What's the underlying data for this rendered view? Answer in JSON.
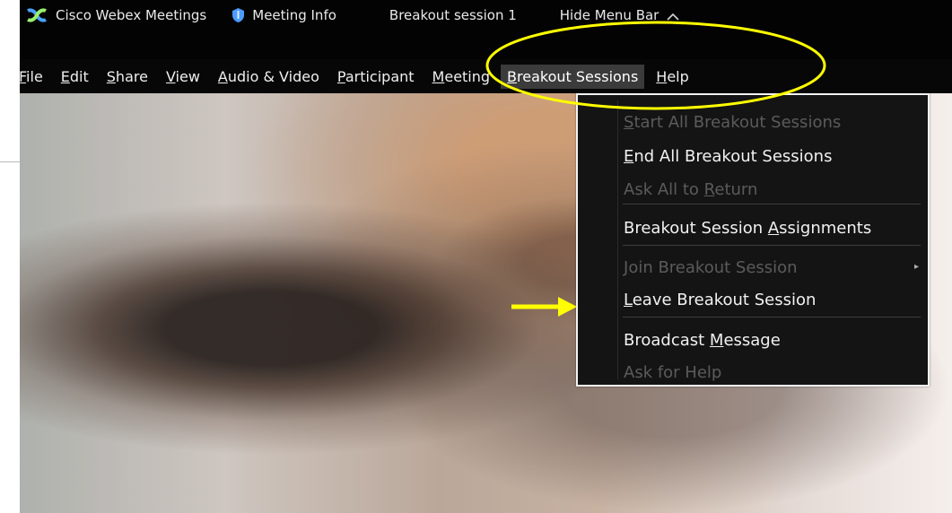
{
  "window": {
    "app_name": "Cisco Webex Meetings",
    "meeting_info": "Meeting Info",
    "breakout_session": "Breakout session 1",
    "hide_menu_bar": "Hide Menu Bar"
  },
  "menu": {
    "items": [
      "File",
      "Edit",
      "Share",
      "View",
      "Audio & Video",
      "Participant",
      "Meeting",
      "Breakout Sessions",
      "Help"
    ],
    "active": "Breakout Sessions"
  },
  "dropdown": {
    "items": [
      {
        "label": "Start All Breakout Sessions",
        "enabled": false
      },
      {
        "label": "End All Breakout Sessions",
        "enabled": true
      },
      {
        "label": "Ask All to Return",
        "enabled": false
      },
      {
        "label": "Breakout Session Assignments",
        "enabled": true
      },
      {
        "label": "Join Breakout Session",
        "enabled": false,
        "submenu": true
      },
      {
        "label": "Leave Breakout Session",
        "enabled": true
      },
      {
        "label": "Broadcast Message",
        "enabled": true
      },
      {
        "label": "Ask for Help",
        "enabled": false
      }
    ]
  },
  "colors": {
    "titlebar": "#030303",
    "menu_active": "#3b3b3b",
    "highlight": "#ffff00"
  },
  "icons": {
    "app": "webex-logo-icon",
    "info": "shield-icon",
    "collapse": "chevron-up-icon",
    "submenu": "chevron-right-icon",
    "annotation_arrow": "right-arrow-icon"
  }
}
